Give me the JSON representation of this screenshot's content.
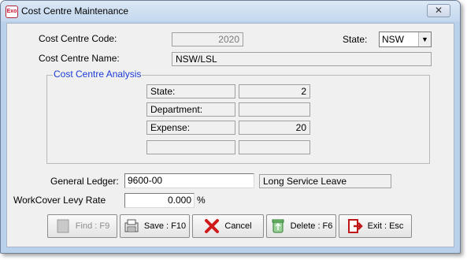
{
  "window": {
    "title": "Cost Centre Maintenance",
    "app_icon_text": "Exo",
    "close_glyph": "✕"
  },
  "form": {
    "cost_centre_code": {
      "label": "Cost Centre Code:",
      "value": "2020"
    },
    "state": {
      "label": "State:",
      "value": "NSW"
    },
    "cost_centre_name": {
      "label": "Cost Centre Name:",
      "value": "NSW/LSL"
    }
  },
  "analysis": {
    "title": "Cost Centre Analysis",
    "rows": [
      {
        "label": "State:",
        "value": "2"
      },
      {
        "label": "Department:",
        "value": ""
      },
      {
        "label": "Expense:",
        "value": "20"
      },
      {
        "label": "",
        "value": ""
      }
    ]
  },
  "general_ledger": {
    "label": "General Ledger:",
    "value": "9600-00",
    "description": "Long Service Leave"
  },
  "workcover": {
    "label": "WorkCover Levy Rate",
    "value": "0.000",
    "unit": "%"
  },
  "buttons": {
    "find": "Find : F9",
    "save": "Save : F10",
    "cancel": "Cancel",
    "delete": "Delete : F6",
    "exit": "Exit : Esc"
  }
}
